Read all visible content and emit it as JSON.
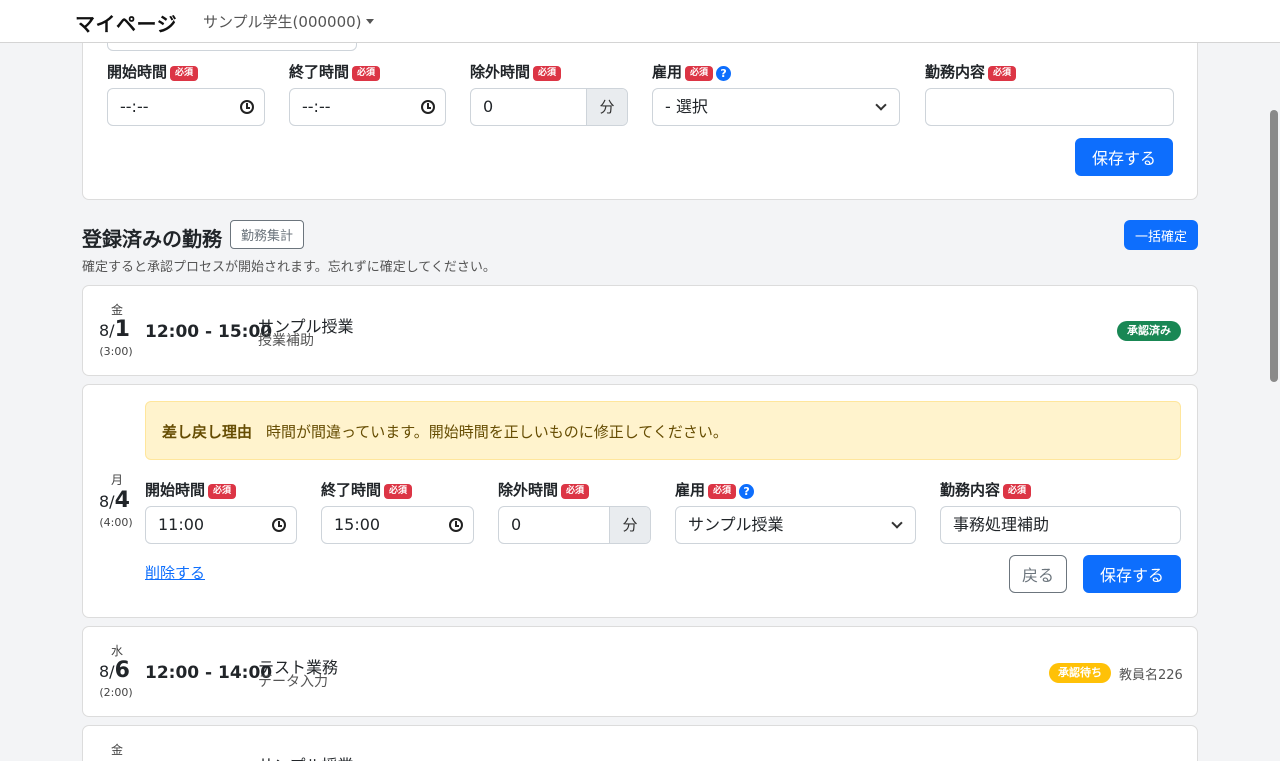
{
  "navbar": {
    "brand": "マイページ",
    "user": "サンプル学生(000000)"
  },
  "new_entry_form": {
    "start_label": "開始時間",
    "end_label": "終了時間",
    "exclude_label": "除外時間",
    "employment_label": "雇用",
    "work_content_label": "勤務内容",
    "required_badge": "必須",
    "help_icon": "?",
    "start_value": "--:--",
    "end_value": "--:--",
    "exclude_value": "0",
    "minute_unit": "分",
    "employment_value": "- 選択",
    "work_content_value": "",
    "save_label": "保存する"
  },
  "registered": {
    "title": "登録済みの勤務",
    "summary_button": "勤務集計",
    "bulk_confirm_button": "一括確定",
    "description": "確定すると承認プロセスが開始されます。忘れずに確定してください。"
  },
  "entries": [
    {
      "dow": "金",
      "month": "8/",
      "day": "1",
      "duration": "(3:00)",
      "time_range": "12:00 - 15:00",
      "job": "サンプル授業",
      "task": "授業補助",
      "status": "承認済み",
      "status_color": "#198754"
    },
    {
      "dow": "月",
      "month": "8/",
      "day": "4",
      "duration": "(4:00)",
      "alert_title": "差し戻し理由",
      "alert_text": "時間が間違っています。開始時間を正しいものに修正してください。",
      "start_label": "開始時間",
      "end_label": "終了時間",
      "exclude_label": "除外時間",
      "employment_label": "雇用",
      "work_content_label": "勤務内容",
      "start_value": "11:00",
      "end_value": "15:00",
      "exclude_value": "0",
      "minute_unit": "分",
      "employment_value": "サンプル授業",
      "work_content_value": "事務処理補助",
      "delete_label": "削除する",
      "back_label": "戻る",
      "save_label": "保存する"
    },
    {
      "dow": "水",
      "month": "8/",
      "day": "6",
      "duration": "(2:00)",
      "time_range": "12:00 - 14:00",
      "job": "テスト業務",
      "task": "データ入力",
      "status": "承認待ち",
      "status_color": "#ffc107",
      "approver": "教員名226"
    },
    {
      "dow": "金",
      "job": "サンプル授業"
    }
  ],
  "colors": {
    "primary": "#0d6efd",
    "danger": "#dc3545",
    "success": "#198754",
    "warning": "#ffc107",
    "alert_bg": "#fff3cd"
  }
}
